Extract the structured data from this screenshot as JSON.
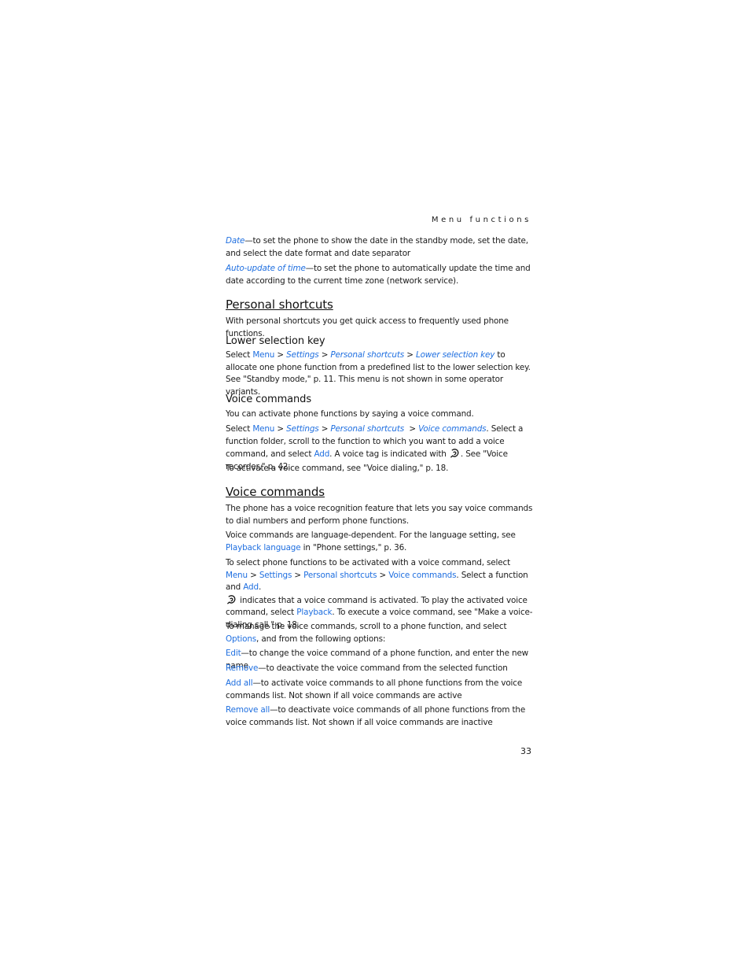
{
  "running_head": "Menu functions",
  "page_number": "33",
  "intro_items": [
    {
      "term": "Date",
      "text": "—to set the phone to show the date in the standby mode, set the date, and select the date format and date separator"
    },
    {
      "term": "Auto-update of time",
      "text": "—to set the phone to automatically update the time and date according to the current time zone (network service)."
    }
  ],
  "section1": {
    "heading": "Personal shortcuts",
    "intro": "With personal shortcuts you get quick access to frequently used phone functions.",
    "lower_key": {
      "heading": "Lower selection key",
      "select": "Select ",
      "menu": "Menu",
      "sep": " > ",
      "settings": "Settings",
      "personal": "Personal shortcuts",
      "lower": "Lower selection key",
      "rest": " to allocate one phone function from a predefined list to the lower selection key. See \"Standby mode,\" p. 11. This menu is not shown in some operator variants."
    },
    "voice_sub": {
      "heading": "Voice commands",
      "p1": "You can activate phone functions by saying a voice command.",
      "select": "Select ",
      "menu": "Menu",
      "sep": " > ",
      "settings": "Settings",
      "personal": "Personal shortcuts",
      "sep2": "  > ",
      "voice": "Voice commands",
      "rest1": ". Select a function folder, scroll to the function to which you want to add a voice command, and select ",
      "add": "Add",
      "rest2": ". A voice tag is indicated with ",
      "rest3": ". See \"Voice recorder,\" p. 42.",
      "p3": "To activate a voice command, see \"Voice dialing,\" p. 18."
    }
  },
  "section2": {
    "heading": "Voice commands",
    "p1": "The phone has a voice recognition feature that lets you say voice commands to dial numbers and perform phone functions.",
    "p2a": "Voice commands are language-dependent. For the language setting, see ",
    "playback_language": "Playback language",
    "p2b": " in \"Phone settings,\" p. 36.",
    "p3a": "To select phone functions to be activated with a voice command, select ",
    "menu": "Menu",
    "sep": " > ",
    "settings": "Settings",
    "personal": "Personal shortcuts",
    "voice": "Voice commands",
    "p3b": ". Select a function and ",
    "add": "Add",
    "p3c": ".",
    "p3d": " indicates that a voice command is activated. To play the activated voice command, select ",
    "playback": "Playback",
    "p3e": ". To execute a voice command, see \"Make a voice-dialing call,\" p. 18.",
    "p4a": "To manage the voice commands, scroll to a phone function, and select ",
    "options": "Options",
    "p4b": ", and from the following options:",
    "options_list": [
      {
        "term": "Edit",
        "text": "—to change the voice command of a phone function, and enter the new name"
      },
      {
        "term": "Remove",
        "text": "—to deactivate the voice command from the selected function"
      },
      {
        "term": "Add all",
        "text": "—to activate voice commands to all phone functions from the voice commands list. Not shown if all voice commands are active"
      },
      {
        "term": "Remove all",
        "text": "—to deactivate voice commands of all phone functions from the voice commands list. Not shown if all voice commands are inactive"
      }
    ]
  },
  "colors": {
    "link": "#1f6fe0",
    "text": "#1a1a1a"
  }
}
